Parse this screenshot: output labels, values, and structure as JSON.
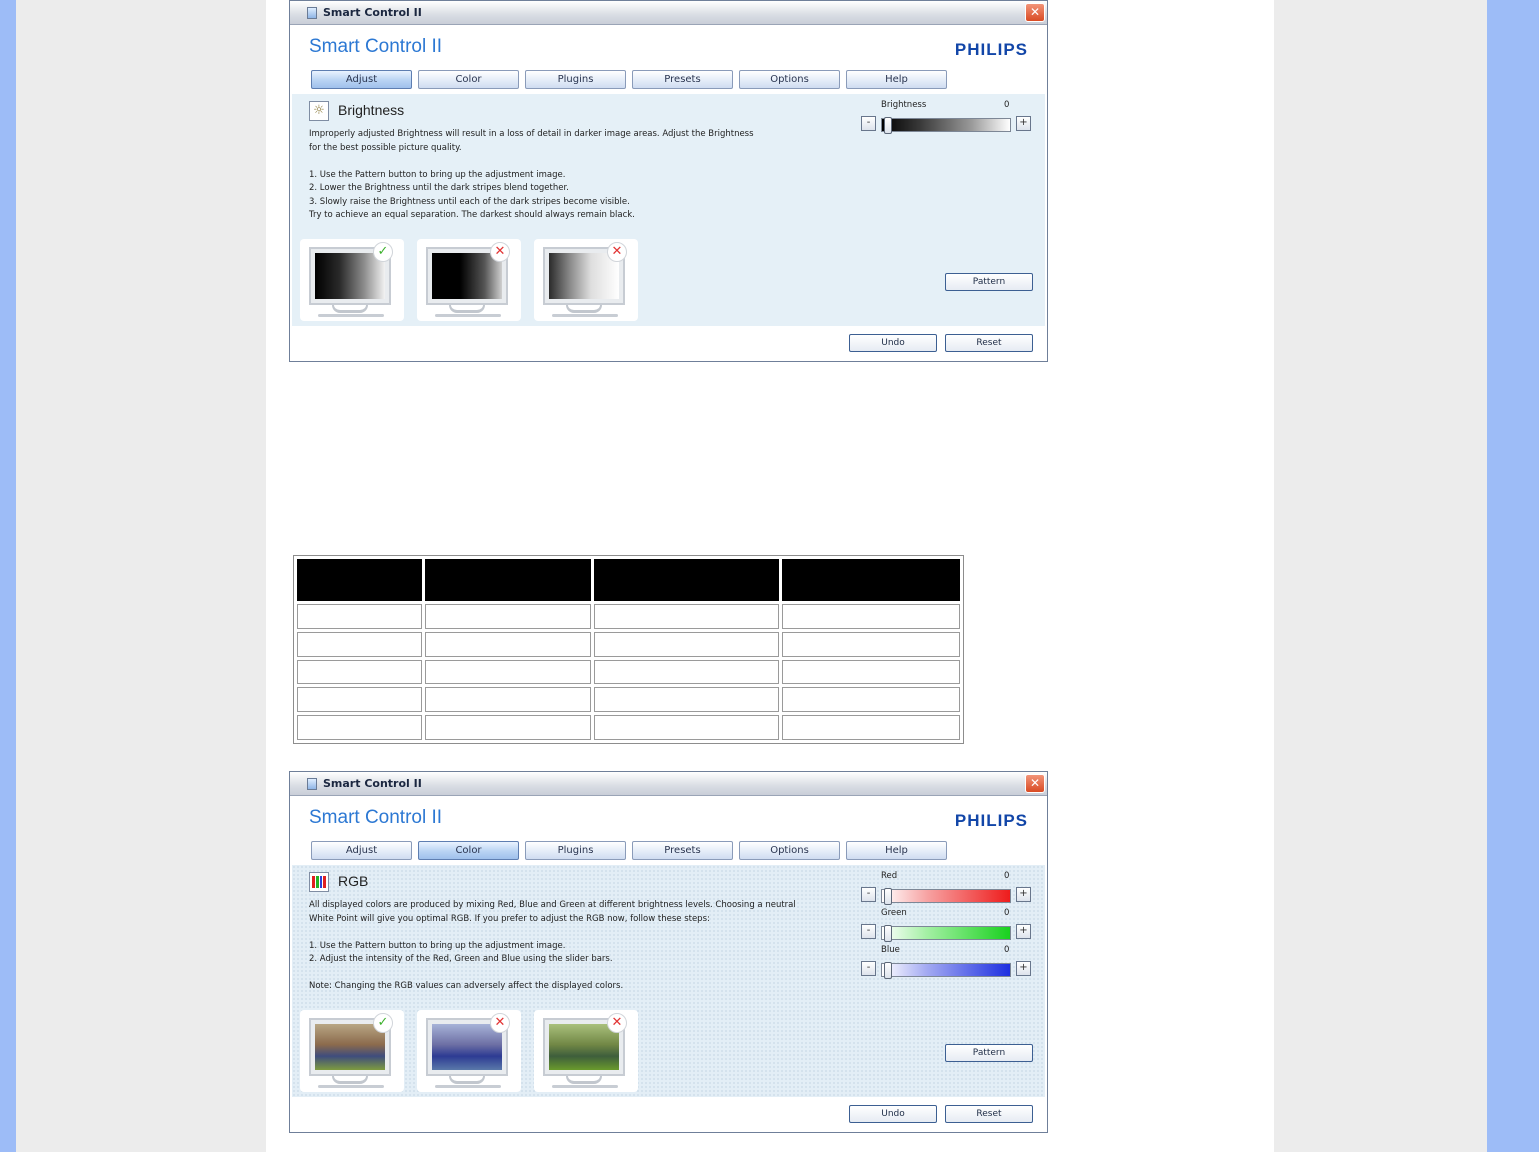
{
  "screenshots": [
    {
      "window_title": "Smart Control II",
      "app_title": "Smart Control II",
      "brand": "PHILIPS",
      "tabs": [
        "Adjust",
        "Color",
        "Plugins",
        "Presets",
        "Options",
        "Help"
      ],
      "active_tab": "Adjust",
      "section_title": "Brightness",
      "section_icon": "sun-icon",
      "description": "Improperly adjusted Brightness will result in a loss of detail in darker image areas. Adjust the Brightness\nfor the best possible picture quality.\n\n1. Use the Pattern button to bring up the adjustment image.\n2. Lower the Brightness until the dark stripes blend together.\n3. Slowly raise the Brightness until each of the dark stripes become visible.\n   Try to achieve an equal separation. The darkest should always remain black.",
      "sliders": [
        {
          "label": "Brightness",
          "value": "0",
          "fraction": 0.0
        }
      ],
      "examples": [
        {
          "name": "correct-example",
          "status": "✓"
        },
        {
          "name": "too-dark-example",
          "status": "✕"
        },
        {
          "name": "too-bright-example",
          "status": "✕"
        }
      ],
      "pattern_button": "Pattern",
      "undo_button": "Undo",
      "reset_button": "Reset"
    },
    {
      "window_title": "Smart Control II",
      "app_title": "Smart Control II",
      "brand": "PHILIPS",
      "tabs": [
        "Adjust",
        "Color",
        "Plugins",
        "Presets",
        "Options",
        "Help"
      ],
      "active_tab": "Color",
      "section_title": "RGB",
      "section_icon": "rgb-bars-icon",
      "description": "All displayed colors are produced by mixing Red, Blue and Green at different brightness levels. Choosing a neutral\nWhite Point will give you optimal RGB. If you prefer to adjust the RGB now, follow these steps:\n\n1. Use the Pattern button to bring up the adjustment image.\n2. Adjust the intensity of the Red, Green and Blue using the slider bars.\n\nNote: Changing the RGB values can adversely affect the displayed colors.",
      "sliders": [
        {
          "label": "Red",
          "value": "0",
          "fraction": 0.0,
          "color": "#ee1c1c"
        },
        {
          "label": "Green",
          "value": "0",
          "fraction": 0.0,
          "color": "#19d11f"
        },
        {
          "label": "Blue",
          "value": "0",
          "fraction": 0.0,
          "color": "#1d2fe0"
        }
      ],
      "examples": [
        {
          "name": "correct-example",
          "status": "✓"
        },
        {
          "name": "bluish-example",
          "status": "✕"
        },
        {
          "name": "greenish-example",
          "status": "✕"
        }
      ],
      "pattern_button": "Pattern",
      "undo_button": "Undo",
      "reset_button": "Reset"
    }
  ],
  "table": {
    "headers": [
      "",
      "",
      "",
      ""
    ],
    "rows": [
      [
        "",
        "",
        "",
        ""
      ],
      [
        "",
        "",
        "",
        ""
      ],
      [
        "",
        "",
        "",
        ""
      ],
      [
        "",
        "",
        "",
        ""
      ],
      [
        "",
        "",
        "",
        ""
      ]
    ]
  }
}
